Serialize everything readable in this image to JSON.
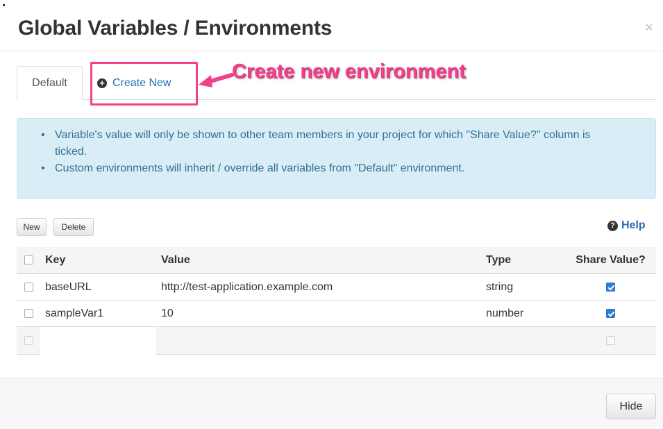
{
  "modal": {
    "title": "Global Variables / Environments",
    "close_symbol": "×"
  },
  "tabs": [
    {
      "label": "Default",
      "active": true
    },
    {
      "label": "Create New",
      "icon": "plus-circle-icon"
    }
  ],
  "annotation": {
    "text": "Create new environment",
    "color": "#f0418a"
  },
  "info": {
    "items": [
      "Variable's value will only be shown to other team members in your project for which \"Share Value?\" column is ticked.",
      "Custom environments will inherit / override all variables from \"Default\" environment."
    ]
  },
  "toolbar": {
    "new_label": "New",
    "delete_label": "Delete",
    "help_label": "Help",
    "help_icon": "question-circle-icon"
  },
  "table": {
    "headers": {
      "key": "Key",
      "value": "Value",
      "type": "Type",
      "share": "Share Value?"
    },
    "rows": [
      {
        "key": "baseURL",
        "value": "http://test-application.example.com",
        "type": "string",
        "share": true
      },
      {
        "key": "sampleVar1",
        "value": "10",
        "type": "number",
        "share": true
      },
      {
        "key": "",
        "value": "",
        "type": "",
        "share": false
      }
    ]
  },
  "footer": {
    "hide_label": "Hide"
  },
  "colors": {
    "link": "#2a6fb5",
    "info_bg": "#d9edf7",
    "info_text": "#31708f",
    "checkbox_checked": "#2f7ce0"
  }
}
